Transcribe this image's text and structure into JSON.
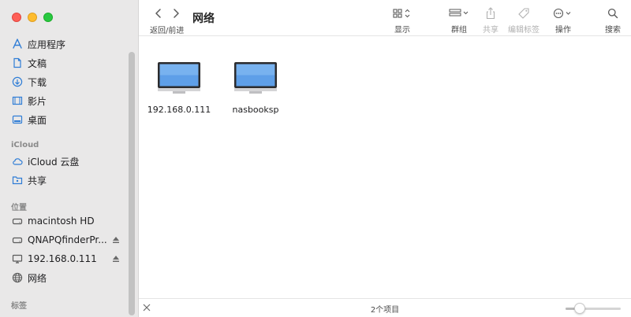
{
  "colors": {
    "accent": "#2f7dd6",
    "sidebar_bg": "#e9e8e8"
  },
  "toolbar": {
    "title": "网络",
    "nav_caption": "返回/前进",
    "tools": {
      "view": "显示",
      "group": "群组",
      "share": "共享",
      "edit_tags": "编辑标签",
      "action": "操作",
      "search": "搜索"
    }
  },
  "sidebar": {
    "favorites": [
      {
        "label": "应用程序",
        "icon": "apps-icon"
      },
      {
        "label": "文稿",
        "icon": "document-icon"
      },
      {
        "label": "下载",
        "icon": "download-icon"
      },
      {
        "label": "影片",
        "icon": "film-icon"
      },
      {
        "label": "桌面",
        "icon": "desktop-icon"
      }
    ],
    "icloud_header": "iCloud",
    "icloud": [
      {
        "label": "iCloud 云盘",
        "icon": "cloud-icon"
      },
      {
        "label": "共享",
        "icon": "shared-folder-icon"
      }
    ],
    "locations_header": "位置",
    "locations": [
      {
        "label": "macintosh HD",
        "icon": "disk-icon"
      },
      {
        "label": "QNAPQfinderPr...",
        "icon": "disk-icon"
      },
      {
        "label": "192.168.0.111",
        "icon": "monitor-icon"
      },
      {
        "label": "网络",
        "icon": "globe-icon"
      }
    ],
    "tags_header": "标签"
  },
  "files": [
    {
      "name": "192.168.0.111",
      "icon": "computer-icon"
    },
    {
      "name": "nasbooksp",
      "icon": "computer-icon"
    }
  ],
  "status": {
    "item_count": "2个项目",
    "icon_size": 0.25
  }
}
